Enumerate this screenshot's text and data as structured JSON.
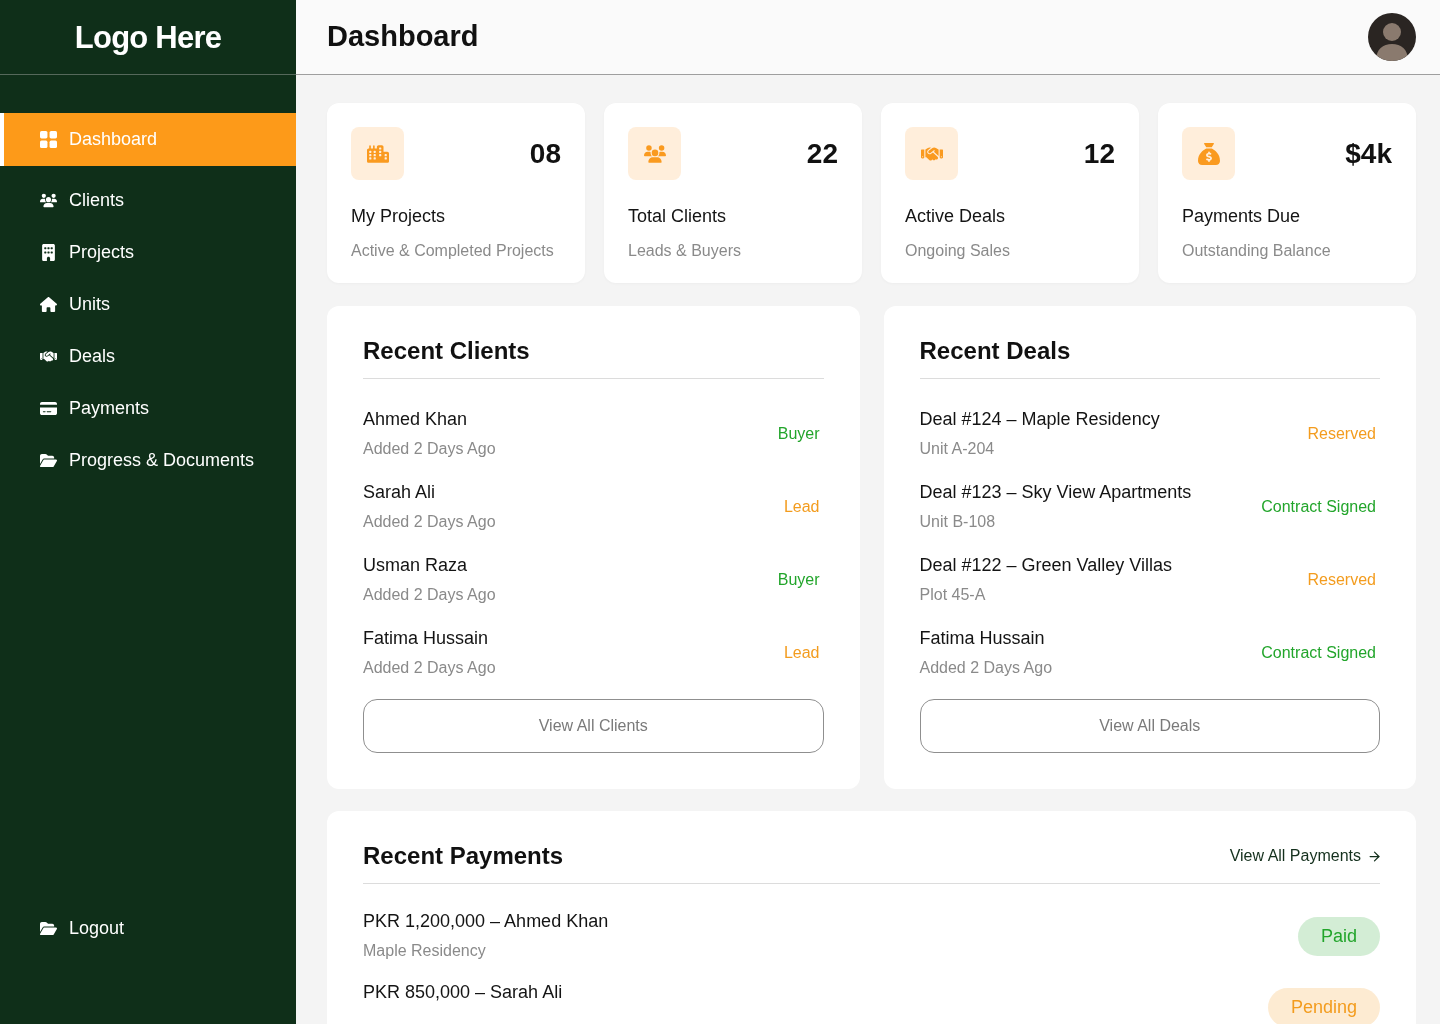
{
  "sidebar": {
    "logo": "Logo Here",
    "items": [
      {
        "label": "Dashboard",
        "selected": true
      },
      {
        "label": "Clients",
        "selected": false
      },
      {
        "label": "Projects",
        "selected": false
      },
      {
        "label": "Units",
        "selected": false
      },
      {
        "label": "Deals",
        "selected": false
      },
      {
        "label": "Payments",
        "selected": false
      },
      {
        "label": "Progress & Documents",
        "selected": false
      }
    ],
    "logout": {
      "label": "Logout"
    }
  },
  "header": {
    "title": "Dashboard"
  },
  "stats": [
    {
      "value": "08",
      "title": "My Projects",
      "subtitle": "Active & Completed Projects"
    },
    {
      "value": "22",
      "title": "Total Clients",
      "subtitle": "Leads & Buyers"
    },
    {
      "value": "12",
      "title": "Active Deals",
      "subtitle": "Ongoing Sales"
    },
    {
      "value": "$4k",
      "title": "Payments Due",
      "subtitle": "Outstanding Balance"
    }
  ],
  "recent_clients": {
    "title": "Recent Clients",
    "rows": [
      {
        "name": "Ahmed Khan",
        "added": "Added 2 Days Ago",
        "type": "Buyer",
        "color": "#22a52b"
      },
      {
        "name": "Sarah Ali",
        "added": "Added 2 Days Ago",
        "type": "Lead",
        "color": "#f39c1e"
      },
      {
        "name": "Usman Raza",
        "added": "Added 2 Days Ago",
        "type": "Buyer",
        "color": "#22a52b"
      },
      {
        "name": "Fatima Hussain",
        "added": "Added 2 Days Ago",
        "type": "Lead",
        "color": "#f39c1e"
      }
    ],
    "button": "View All Clients"
  },
  "recent_deals": {
    "title": "Recent Deals",
    "rows": [
      {
        "title": "Deal #124 – Maple Residency",
        "detail": "Unit A-204",
        "status": "Reserved",
        "color": "#f39c1e"
      },
      {
        "title": "Deal #123 – Sky View Apartments",
        "detail": "Unit B-108",
        "status": "Contract Signed",
        "color": "#22a52b"
      },
      {
        "title": "Deal #122 – Green Valley Villas",
        "detail": "Plot 45-A",
        "status": "Reserved",
        "color": "#f39c1e"
      },
      {
        "title": "Fatima Hussain",
        "detail": "Added 2 Days Ago",
        "status": "Contract Signed",
        "color": "#22a52b"
      }
    ],
    "button": "View All Deals"
  },
  "recent_payments": {
    "title": "Recent Payments",
    "link": "View All Payments",
    "rows": [
      {
        "title": "PKR 1,200,000 – Ahmed Khan",
        "detail": "Maple Residency",
        "status": "Paid",
        "color": "#22a52b"
      },
      {
        "title": "PKR 850,000 – Sarah Ali",
        "status": "Pending",
        "color": "#f39c1e"
      }
    ]
  }
}
